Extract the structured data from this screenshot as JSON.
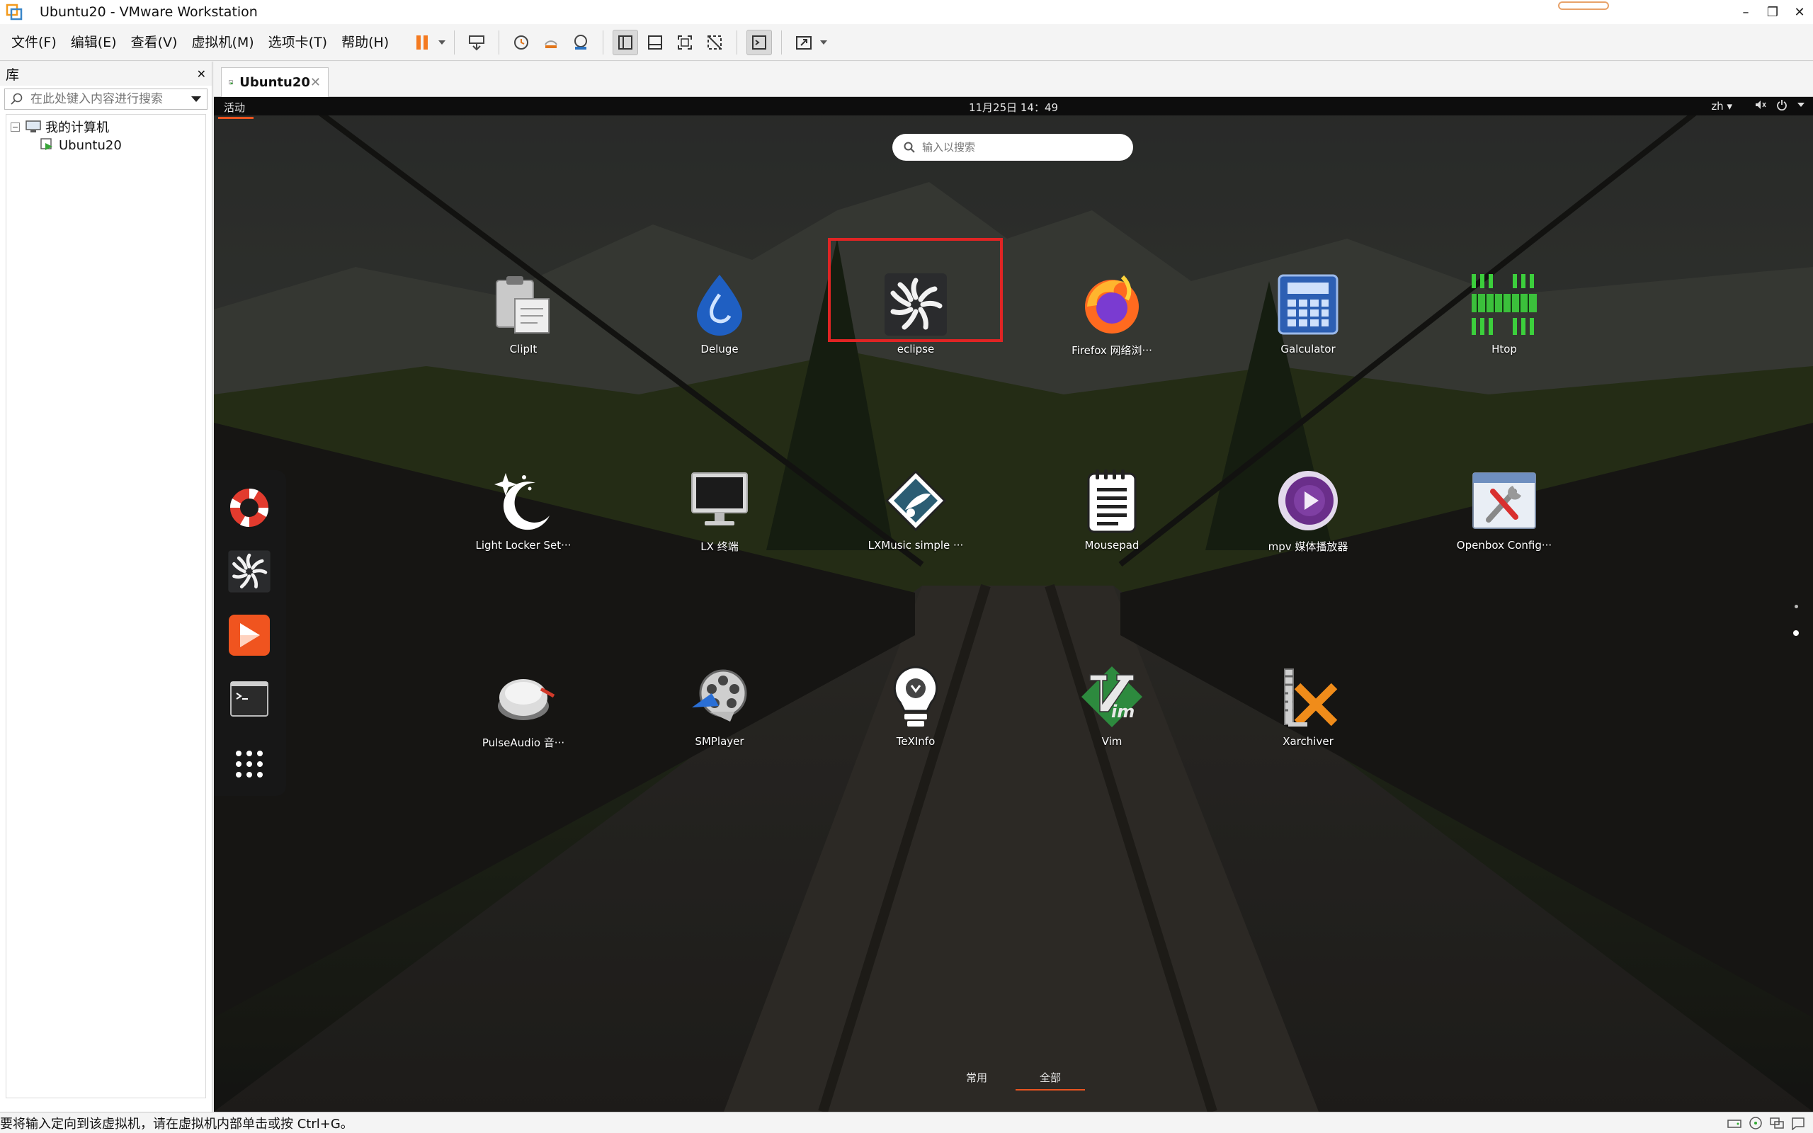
{
  "window": {
    "title": "Ubuntu20 - VMware Workstation",
    "controls": [
      "–",
      "❐",
      "✕"
    ]
  },
  "menubar": {
    "items": [
      "文件(F)",
      "编辑(E)",
      "查看(V)",
      "虚拟机(M)",
      "选项卡(T)",
      "帮助(H)"
    ]
  },
  "library": {
    "title": "库",
    "close": "✕",
    "search_placeholder": "在此处键入内容进行搜索",
    "tree": {
      "root": "我的计算机",
      "expander": "−",
      "child": "Ubuntu20"
    }
  },
  "tab": {
    "label": "Ubuntu20",
    "close": "✕"
  },
  "guest": {
    "activities": "活动",
    "clock": "11月25日 14：49",
    "lang": "zh ▾",
    "search_placeholder": "输入以搜索",
    "apps": [
      {
        "label": "ClipIt"
      },
      {
        "label": "Deluge"
      },
      {
        "label": "eclipse"
      },
      {
        "label": "Firefox 网络浏···"
      },
      {
        "label": "Galculator"
      },
      {
        "label": "Htop"
      },
      {
        "label": "Light Locker Set···"
      },
      {
        "label": "LX 终端"
      },
      {
        "label": "LXMusic simple ···"
      },
      {
        "label": "Mousepad"
      },
      {
        "label": "mpv 媒体播放器"
      },
      {
        "label": "Openbox Config···"
      },
      {
        "label": "PulseAudio 音···"
      },
      {
        "label": "SMPlayer"
      },
      {
        "label": "TeXInfo"
      },
      {
        "label": "Vim"
      },
      {
        "label": "Xarchiver"
      }
    ],
    "bottom_tabs": {
      "frequent": "常用",
      "all": "全部",
      "active": "all"
    }
  },
  "statusbar": {
    "message": "要将输入定向到该虚拟机，请在虚拟机内部单击或按 Ctrl+G。"
  },
  "colors": {
    "accent": "#e95420",
    "highlight": "#e02424",
    "pause": "#f47a20"
  }
}
